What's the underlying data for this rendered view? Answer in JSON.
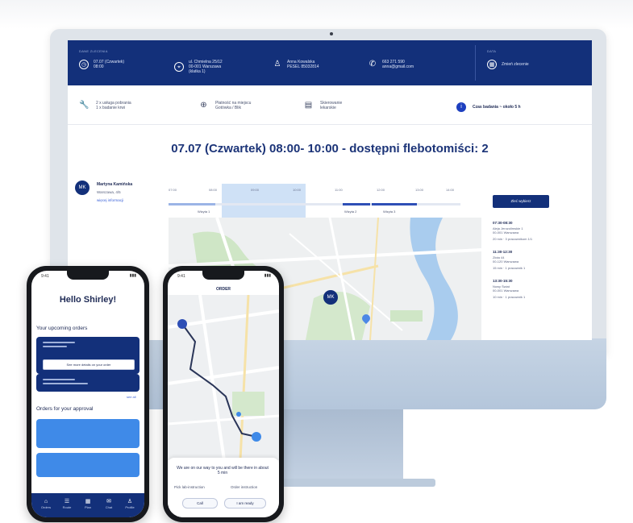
{
  "desktop": {
    "header": {
      "caption_left": "DANE ZLECENIA",
      "caption_right": "DATA",
      "items": [
        {
          "icon": "clock-icon",
          "text": "07.07 (Czwartek)\n08:00"
        },
        {
          "icon": "location-icon",
          "text": "ul. Chmielna 25/12\n00-001 Warszawa\n(klatka 1)"
        },
        {
          "icon": "user-icon",
          "text": "Anna Kowalska\nPESEL 85032814"
        },
        {
          "icon": "phone-icon",
          "text": "663 271 590\nanna@gmail.com"
        },
        {
          "icon": "calendar-icon",
          "text": "Zmień zlecenie"
        }
      ]
    },
    "info_row": [
      {
        "icon": "wrench-icon",
        "text": "2 x usługa pobrania\n1 x badanie krwi"
      },
      {
        "icon": "plus-circle-icon",
        "text": "Płatność na miejscu\nGotówka / Blik"
      },
      {
        "icon": "document-icon",
        "text": "Skierowanie\nlekarskie"
      },
      {
        "icon": "info-icon",
        "text": "Czas badania ~ około 5 h"
      }
    ],
    "headline": "07.07 (Czwartek) 08:00- 10:00 - dostępni flebotomiści: 2",
    "person": {
      "initials": "MK",
      "name": "Martyna Kamińska",
      "sub": "Warszawa, 4/5",
      "link": "więcej informacji"
    },
    "timeline": {
      "ticks": [
        "07:00",
        "08:00",
        "09:00",
        "10:00",
        "11:00",
        "12:00",
        "13:00",
        "14:00"
      ],
      "labels": [
        "Wizyta 1",
        "Wizyta 2",
        "Wizyta 3"
      ],
      "button": "Zleć wybierz"
    },
    "map_pin_labels": [
      "MK",
      "MK"
    ],
    "slots": [
      {
        "time": "07:30-08:30",
        "addr": "Aleja Jerozolimskie 1\n00-001 Warszawa",
        "meta": "20 min   ·   3 pracownikom 1/1"
      },
      {
        "time": "11:30-12:30",
        "addr": "Złota 44\n00-120 Warszawa",
        "meta": "15 min   ·   1 pracownik 1"
      },
      {
        "time": "13:30-15:30",
        "addr": "Nowy Świat\n00-001 Warszawa",
        "meta": "10 min   ·   1 pracownik 1"
      }
    ]
  },
  "phone1": {
    "time": "9:41",
    "greeting": "Hello Shirley!",
    "section1": "Your upcoming orders",
    "inner_button": "See more details on your order",
    "see_all": "see all",
    "section2": "Orders for your approval",
    "nav": [
      {
        "icon": "home-icon",
        "label": "Orders"
      },
      {
        "icon": "list-icon",
        "label": "Route"
      },
      {
        "icon": "calendar-icon",
        "label": "Plan"
      },
      {
        "icon": "chat-icon",
        "label": "Chat"
      },
      {
        "icon": "user-icon",
        "label": "Profile"
      }
    ]
  },
  "phone2": {
    "time": "9:41",
    "title": "ORDER",
    "message": "We are on our way to you and will be there in about 5 min",
    "opt_left": "Pick lab-instruction",
    "opt_right": "Order instruction",
    "btn_left": "Call",
    "btn_right": "I am ready"
  }
}
